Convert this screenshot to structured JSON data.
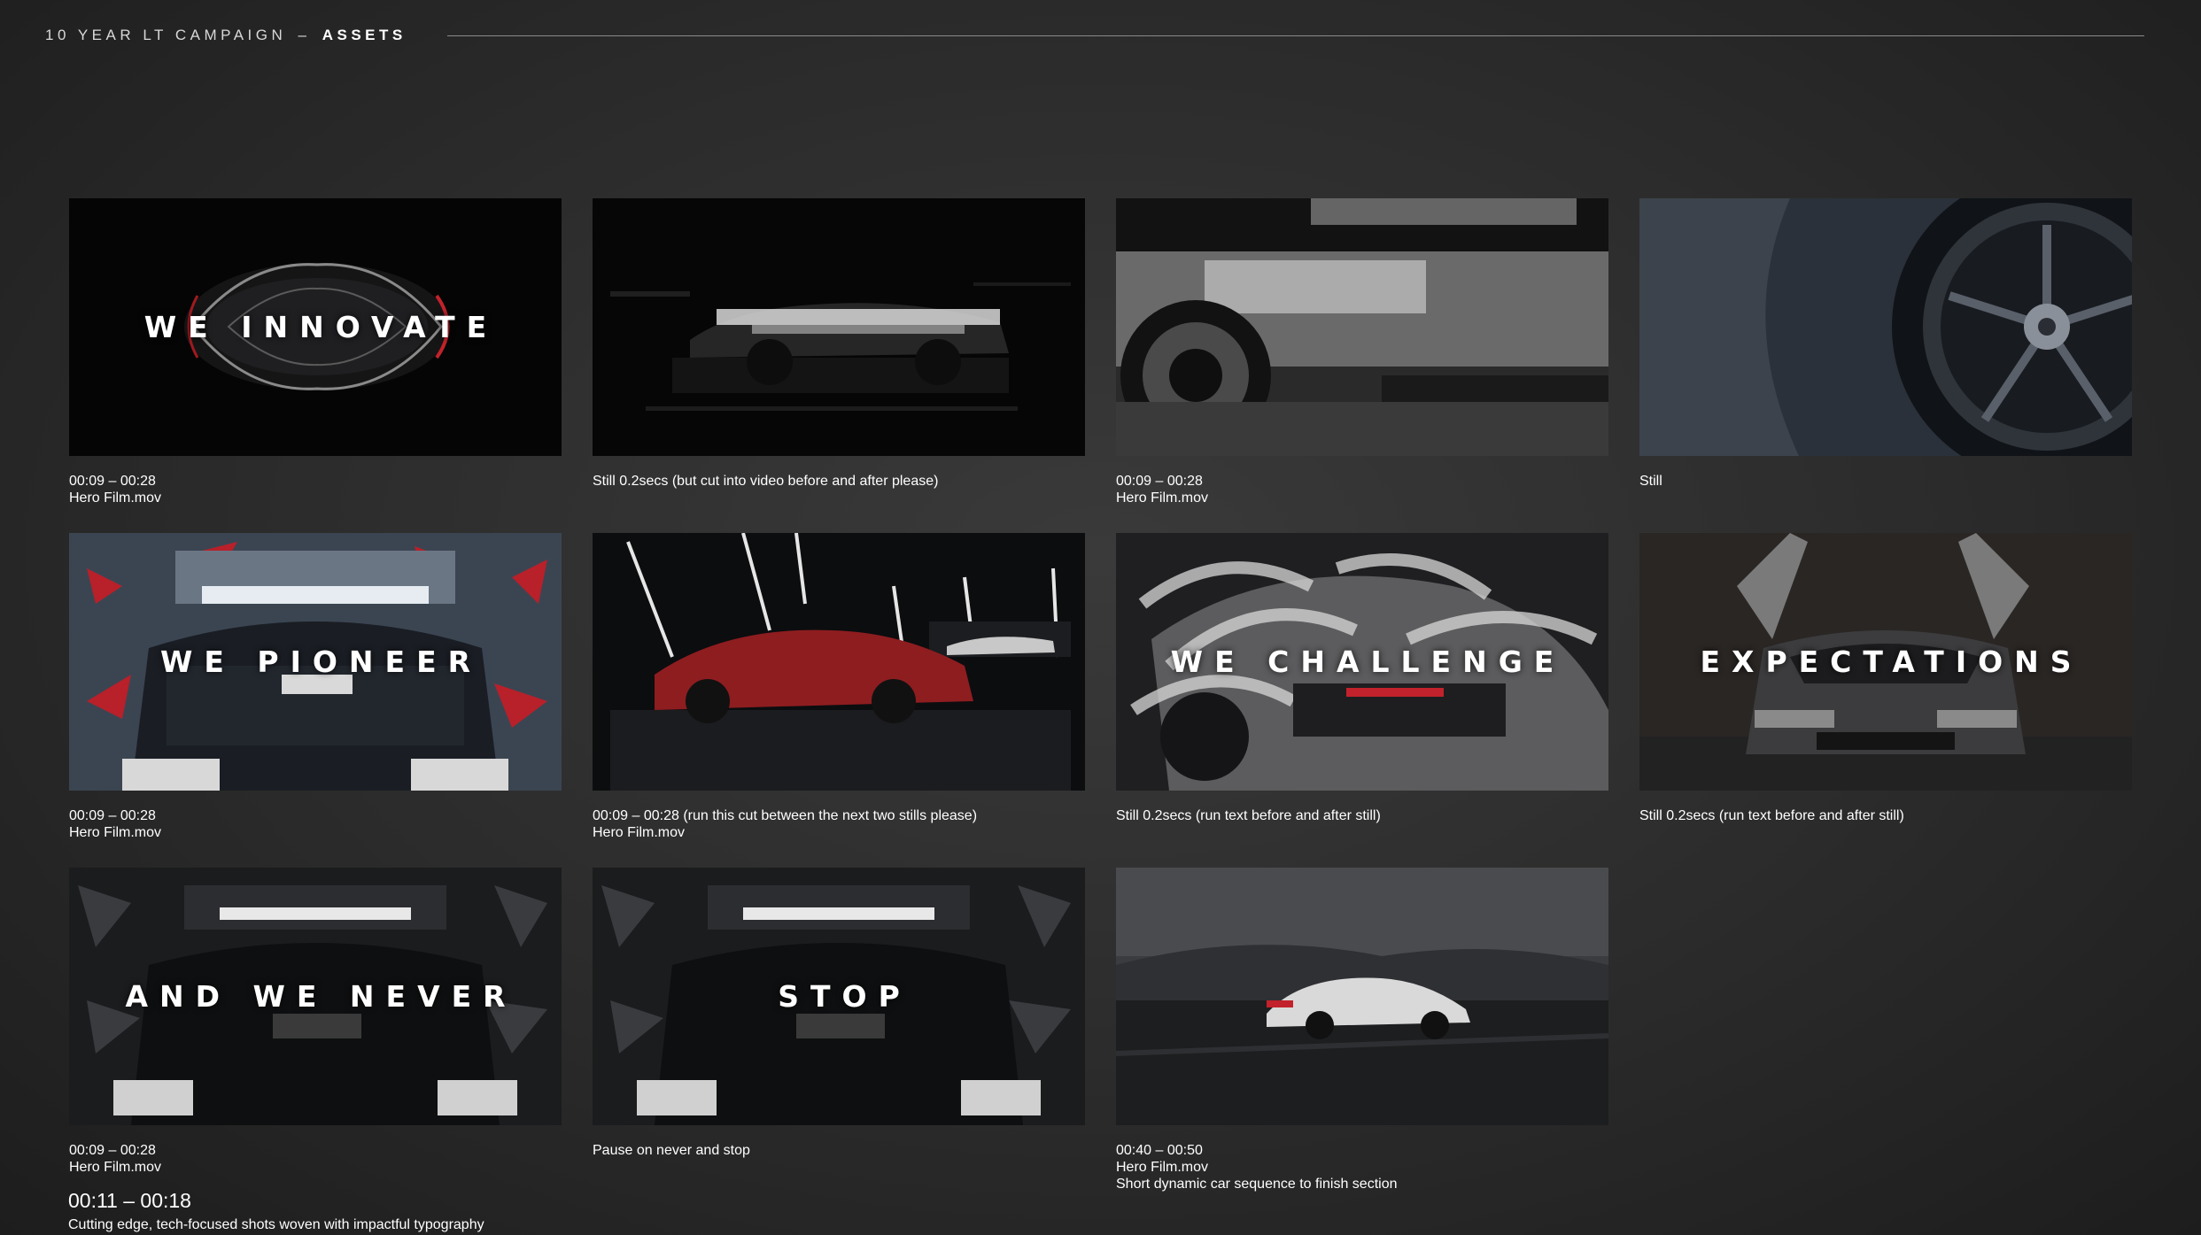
{
  "header": {
    "prefix": "10 YEAR LT CAMPAIGN",
    "separator": "–",
    "section": "ASSETS"
  },
  "assets": [
    {
      "overlay": "WE INNOVATE",
      "caption": [
        "00:09 – 00:28",
        "Hero Film.mov"
      ]
    },
    {
      "overlay": "",
      "caption": [
        "Still 0.2secs (but cut into video before and after please)"
      ]
    },
    {
      "overlay": "",
      "caption": [
        "00:09 – 00:28",
        "Hero Film.mov"
      ]
    },
    {
      "overlay": "",
      "caption": [
        "Still"
      ]
    },
    {
      "overlay": "WE PIONEER",
      "caption": [
        "00:09 – 00:28",
        "Hero Film.mov"
      ]
    },
    {
      "overlay": "",
      "caption": [
        "00:09 – 00:28 (run this cut between the next two stills please)",
        "Hero Film.mov"
      ]
    },
    {
      "overlay": "WE CHALLENGE",
      "caption": [
        "Still 0.2secs (run text before and after still)"
      ]
    },
    {
      "overlay": "EXPECTATIONS",
      "caption": [
        "Still 0.2secs (run text before and after still)"
      ]
    },
    {
      "overlay": "AND WE NEVER",
      "caption": [
        "00:09 – 00:28",
        "Hero Film.mov"
      ]
    },
    {
      "overlay": "STOP",
      "caption": [
        "Pause on never and stop"
      ]
    },
    {
      "overlay": "",
      "caption": [
        "00:40 – 00:50",
        "Hero Film.mov",
        "Short dynamic car sequence to finish section"
      ]
    }
  ],
  "summary": {
    "time": "00:11 – 00:18",
    "description": "Cutting edge, tech-focused shots woven with impactful typography"
  },
  "colors": {
    "background": "#2b2b2b",
    "text": "#ffffff",
    "rule": "#8a8a8a",
    "accent_red": "#c2222b"
  }
}
